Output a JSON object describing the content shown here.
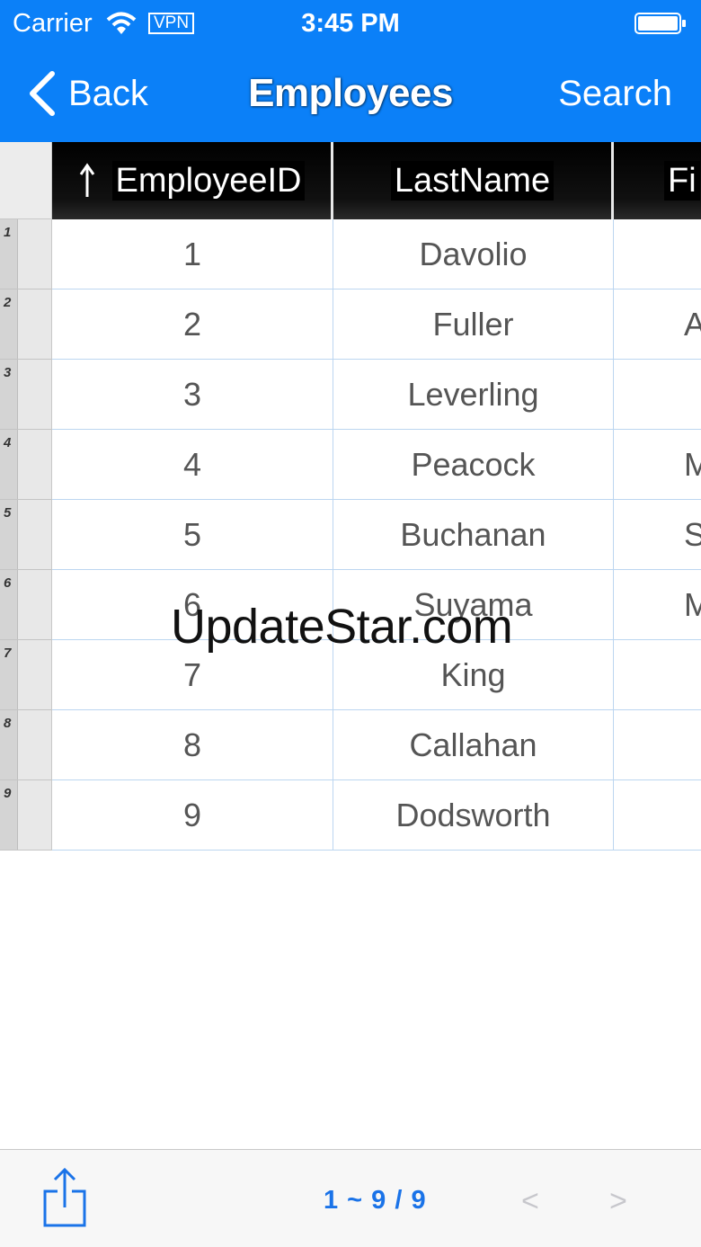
{
  "status_bar": {
    "carrier": "Carrier",
    "vpn": "VPN",
    "time": "3:45 PM"
  },
  "nav": {
    "back_label": "Back",
    "title": "Employees",
    "search_label": "Search"
  },
  "table": {
    "columns": [
      "EmployeeID",
      "LastName",
      "Fi"
    ],
    "rows": [
      {
        "num": "1",
        "id": "1",
        "last": "Davolio",
        "first": ""
      },
      {
        "num": "2",
        "id": "2",
        "last": "Fuller",
        "first": "A"
      },
      {
        "num": "3",
        "id": "3",
        "last": "Leverling",
        "first": ""
      },
      {
        "num": "4",
        "id": "4",
        "last": "Peacock",
        "first": "M"
      },
      {
        "num": "5",
        "id": "5",
        "last": "Buchanan",
        "first": "S"
      },
      {
        "num": "6",
        "id": "6",
        "last": "Suyama",
        "first": "M"
      },
      {
        "num": "7",
        "id": "7",
        "last": "King",
        "first": ""
      },
      {
        "num": "8",
        "id": "8",
        "last": "Callahan",
        "first": ""
      },
      {
        "num": "9",
        "id": "9",
        "last": "Dodsworth",
        "first": ""
      }
    ]
  },
  "watermark": "UpdateStar.com",
  "toolbar": {
    "page_status": "1 ~ 9 / 9",
    "prev": "<",
    "next": ">"
  },
  "colors": {
    "nav_bar": "#0b80f8",
    "accent": "#1a73e8",
    "grid_line": "#bcd6f0"
  }
}
